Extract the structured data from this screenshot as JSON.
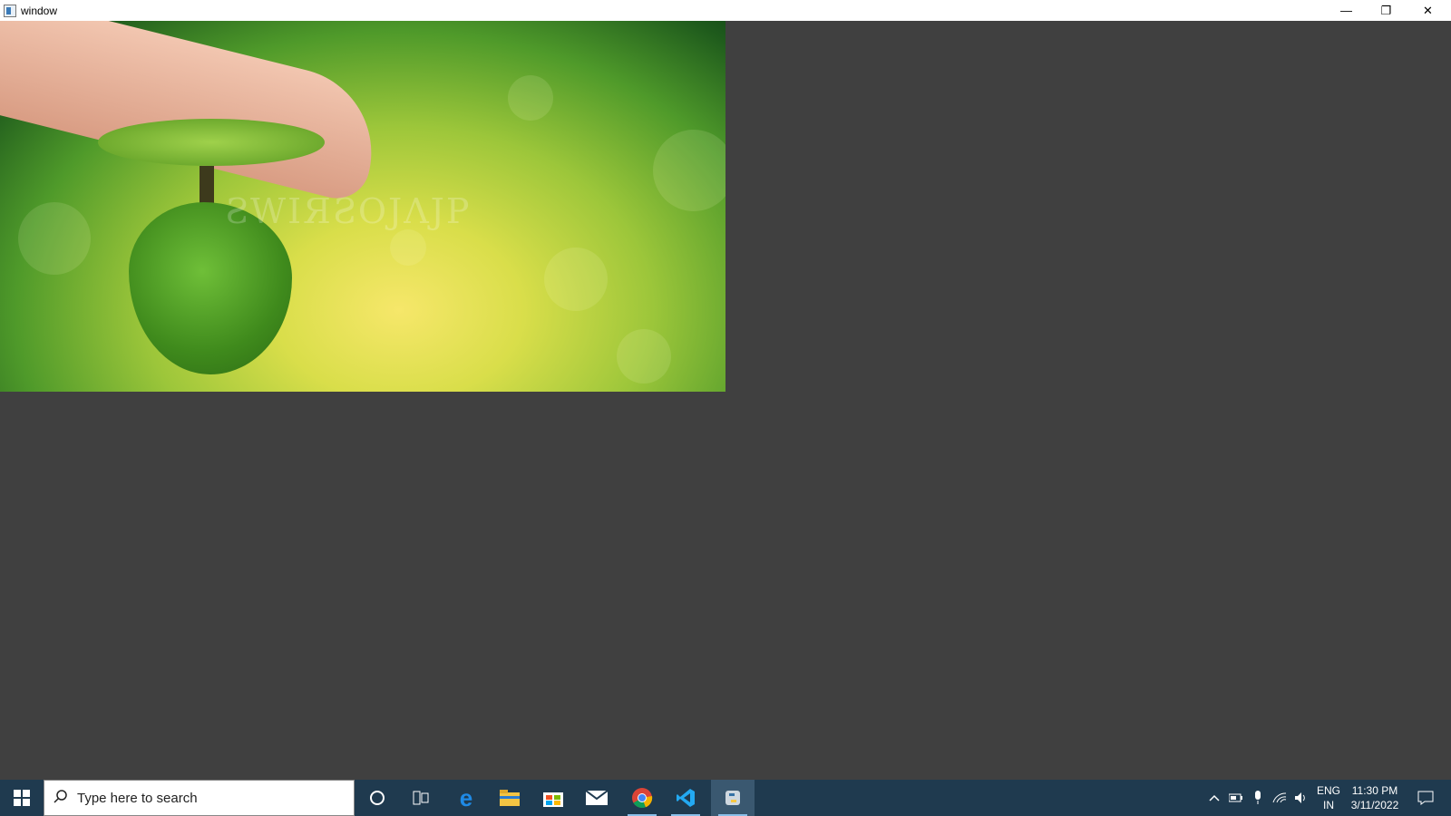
{
  "window": {
    "title": "window",
    "controls": {
      "minimize": "—",
      "restore": "❐",
      "close": "✕"
    }
  },
  "image": {
    "watermark": "ƧWIЯƧOJΛJP"
  },
  "taskbar": {
    "start_icon": "windows-start-icon",
    "search": {
      "placeholder": "Type here to search"
    },
    "apps": [
      {
        "name": "cortana",
        "glyph": "○"
      },
      {
        "name": "task-view",
        "glyph": "❑"
      },
      {
        "name": "edge",
        "glyph": "e"
      },
      {
        "name": "file-explorer",
        "glyph": "▬"
      },
      {
        "name": "store",
        "glyph": "▦"
      },
      {
        "name": "mail",
        "glyph": "✉"
      },
      {
        "name": "chrome",
        "glyph": "◉"
      },
      {
        "name": "vscode",
        "glyph": "⟨⟩"
      },
      {
        "name": "python",
        "glyph": "♒"
      }
    ],
    "tray": {
      "language": "ENG",
      "region": "IN",
      "time": "11:30 PM",
      "date": "3/11/2022"
    }
  },
  "colors": {
    "taskbar": "#1f3a4f",
    "client_bg": "#404040",
    "active_indicator": "#8ac0ea"
  }
}
